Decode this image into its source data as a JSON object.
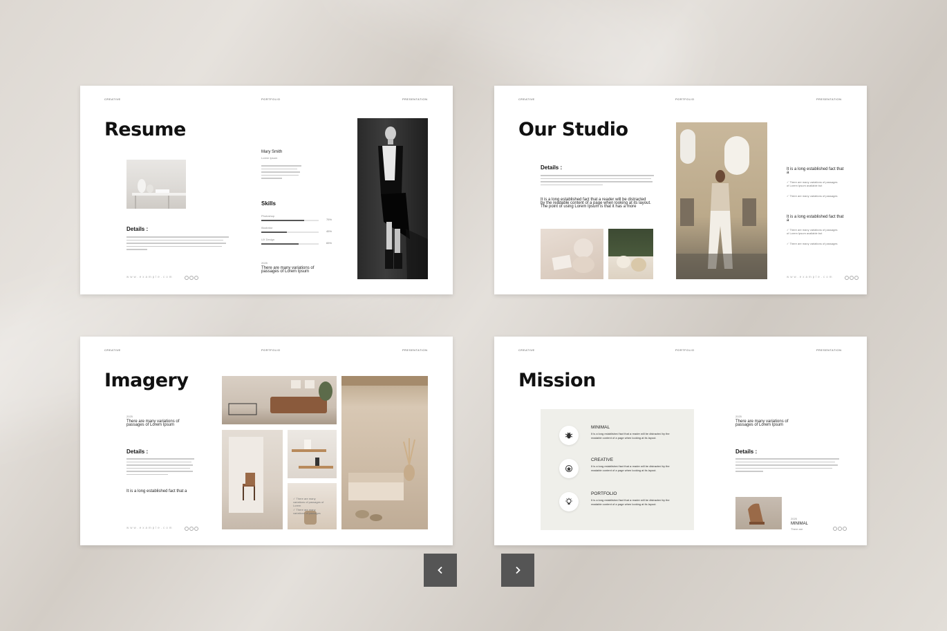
{
  "header": {
    "left": "CREATIVE",
    "center": "PORTFOLIO",
    "right": "PRESENTATION"
  },
  "footer": {
    "url": "www.example.com"
  },
  "lorem": {
    "short": "There are many variations of passages of Lorem Ipsum available but the majority have suffered alteration in some form",
    "long": "There are many variations of passages of Lorem Ipsum available but the majority have suffered alteration in some form, by injected humour, or randomised words which don't look even slightly believable. If you are going to use a passage of Lorem Ipsum",
    "established": "It is a long established fact that a reader will be distracted by the readable content of a page when looking at its layout. The point of using Lorem Ipsum is that it has a more",
    "mission": "It is a long established fact that a reader will be distracted by the readable content of a page when looking at its layout."
  },
  "resume": {
    "title": "Resume",
    "name": "Mary Smith",
    "role": "Lorem Ipsum",
    "bio": "There are many variations of passages of Lorem Ipsum available but the majority have suffered alteration in",
    "details_label": "Details :",
    "skills_label": "Skills",
    "skills": [
      {
        "name": "Photoshop",
        "value": 75,
        "pct": "75%"
      },
      {
        "name": "Illustrator",
        "value": 45,
        "pct": "45%"
      },
      {
        "name": "UX Design",
        "value": 65,
        "pct": "65%"
      }
    ],
    "year": "2025",
    "caption": "There are many variations of passages of Lorem Ipsum"
  },
  "studio": {
    "title": "Our Studio",
    "details_label": "Details :",
    "established": "It is a long established fact that a reader will be distracted by the readable content of a page when looking at its layout. The point of using Lorem Ipsum is that it has a more",
    "side_heading_1": "It is a long established fact that a",
    "side_heading_2": "It is a long established fact that a",
    "checks": [
      "There are many variations of passages of Lorem Ipsum available but",
      "There are many variations of passages"
    ]
  },
  "imagery": {
    "title": "Imagery",
    "year": "2025",
    "caption": "There are many variations of passages of Lorem Ipsum",
    "details_label": "Details :",
    "established": "It is a long established fact that a",
    "checks": [
      "There are many variations of passages of Lorem",
      "There are many variations of passages"
    ]
  },
  "mission": {
    "title": "Mission",
    "items": [
      {
        "label": "MINIMAL",
        "icon": "bug-icon"
      },
      {
        "label": "CREATIVE",
        "icon": "badge-icon"
      },
      {
        "label": "PORTFOLIO",
        "icon": "bulb-icon"
      }
    ],
    "year": "2025",
    "caption": "There are many variations of passages of Lorem Ipsum",
    "details_label": "Details :",
    "bottom_year": "2025",
    "bottom_label": "MINIMAL",
    "bottom_sub": "There are"
  },
  "nav": {
    "prev_icon": "chevron-left-icon",
    "next_icon": "chevron-right-icon"
  }
}
